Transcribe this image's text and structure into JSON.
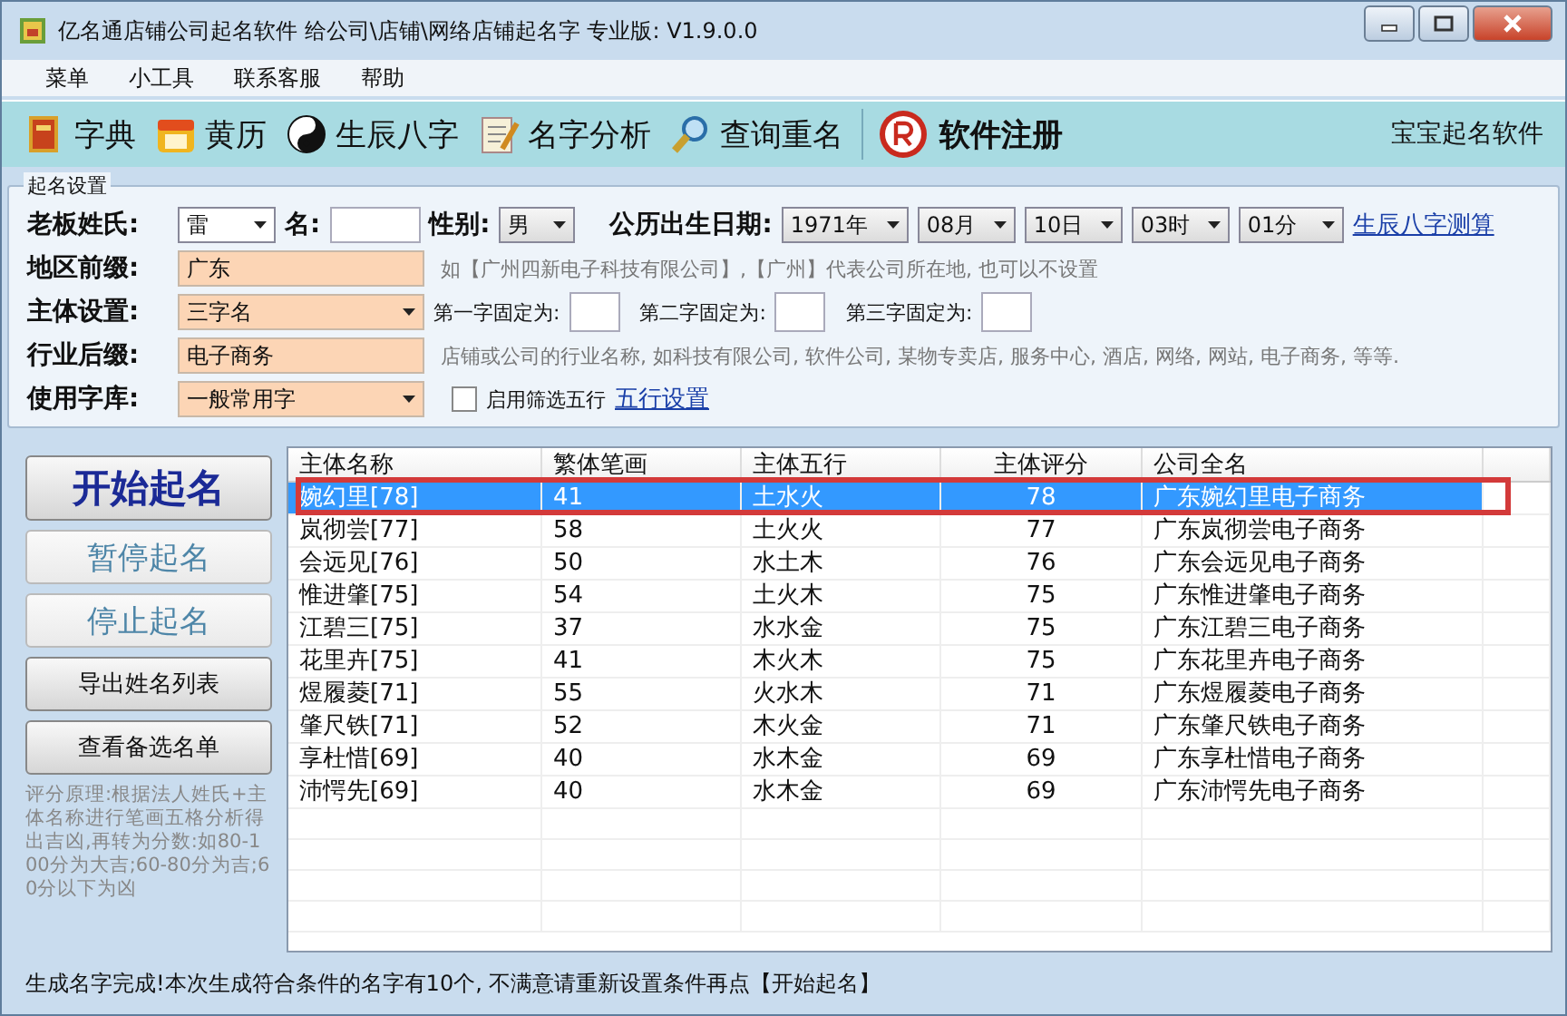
{
  "window": {
    "title": "亿名通店铺公司起名软件 给公司\\店铺\\网络店铺起名字  专业版: V1.9.0.0"
  },
  "menu": [
    "菜单",
    "小工具",
    "联系客服",
    "帮助"
  ],
  "toolbar": [
    {
      "label": "字典",
      "kind": "book"
    },
    {
      "label": "黄历",
      "kind": "calendar"
    },
    {
      "label": "生辰八字",
      "kind": "yinyang"
    },
    {
      "label": "名字分析",
      "kind": "notepad"
    },
    {
      "label": "查询重名",
      "kind": "magnifier"
    },
    {
      "label": "软件注册",
      "kind": "registered"
    }
  ],
  "toolbar_right": "宝宝起名软件",
  "settings": {
    "title": "起名设置",
    "surname_label": "老板姓氏:",
    "surname": "雷",
    "name_label": "名:",
    "gender_label": "性别:",
    "gender": "男",
    "birth_label": "公历出生日期:",
    "birth": [
      "1971年",
      "08月",
      "10日",
      "03时",
      "01分"
    ],
    "bazi_link": "生辰八字测算",
    "region_label": "地区前缀:",
    "region": "广东",
    "region_hint": "如【广州四新电子科技有限公司】,【广州】代表公司所在地, 也可以不设置",
    "main_label": "主体设置:",
    "main": "三字名",
    "fixed": [
      "第一字固定为:",
      "第二字固定为:",
      "第三字固定为:"
    ],
    "industry_label": "行业后缀:",
    "industry": "电子商务",
    "industry_hint": "店铺或公司的行业名称, 如科技有限公司, 软件公司, 某物专卖店, 服务中心, 酒店, 网络, 网站, 电子商务, 等等.",
    "charset_label": "使用字库:",
    "charset": "一般常用字",
    "filter_label": "启用筛选五行",
    "filter_checked": false,
    "wuxing_link": "五行设置"
  },
  "buttons": [
    {
      "label": "开始起名",
      "kind": "primary",
      "disabled": false
    },
    {
      "label": "暂停起名",
      "kind": "large",
      "disabled": true
    },
    {
      "label": "停止起名",
      "kind": "large",
      "disabled": true
    },
    {
      "label": "导出姓名列表",
      "kind": "normal",
      "disabled": false
    },
    {
      "label": "查看备选名单",
      "kind": "normal",
      "disabled": false
    }
  ],
  "note": "评分原理:根据法人姓氏+主体名称进行笔画五格分析得出吉凶,再转为分数:如80-100分为大吉;60-80分为吉;60分以下为凶",
  "table": {
    "columns": [
      "主体名称",
      "繁体笔画",
      "主体五行",
      "主体评分",
      "公司全名"
    ],
    "rows": [
      {
        "cells": [
          "婉幻里[78]",
          "41",
          "土水火",
          "78",
          "广东婉幻里电子商务"
        ],
        "selected": true
      },
      {
        "cells": [
          "岚彻尝[77]",
          "58",
          "土火火",
          "77",
          "广东岚彻尝电子商务"
        ],
        "selected": false
      },
      {
        "cells": [
          "会远见[76]",
          "50",
          "水土木",
          "76",
          "广东会远见电子商务"
        ],
        "selected": false
      },
      {
        "cells": [
          "惟进肇[75]",
          "54",
          "土火木",
          "75",
          "广东惟进肇电子商务"
        ],
        "selected": false
      },
      {
        "cells": [
          "江碧三[75]",
          "37",
          "水水金",
          "75",
          "广东江碧三电子商务"
        ],
        "selected": false
      },
      {
        "cells": [
          "花里卉[75]",
          "41",
          "木火木",
          "75",
          "广东花里卉电子商务"
        ],
        "selected": false
      },
      {
        "cells": [
          "煜履菱[71]",
          "55",
          "火水木",
          "71",
          "广东煜履菱电子商务"
        ],
        "selected": false
      },
      {
        "cells": [
          "肇尺铁[71]",
          "52",
          "木火金",
          "71",
          "广东肇尺铁电子商务"
        ],
        "selected": false
      },
      {
        "cells": [
          "享杜惜[69]",
          "40",
          "水木金",
          "69",
          "广东享杜惜电子商务"
        ],
        "selected": false
      },
      {
        "cells": [
          "沛愕先[69]",
          "40",
          "水木金",
          "69",
          "广东沛愕先电子商务"
        ],
        "selected": false
      }
    ]
  },
  "status_bar": "生成名字完成!本次生成符合条件的名字有10个, 不满意请重新设置条件再点【开始起名】"
}
